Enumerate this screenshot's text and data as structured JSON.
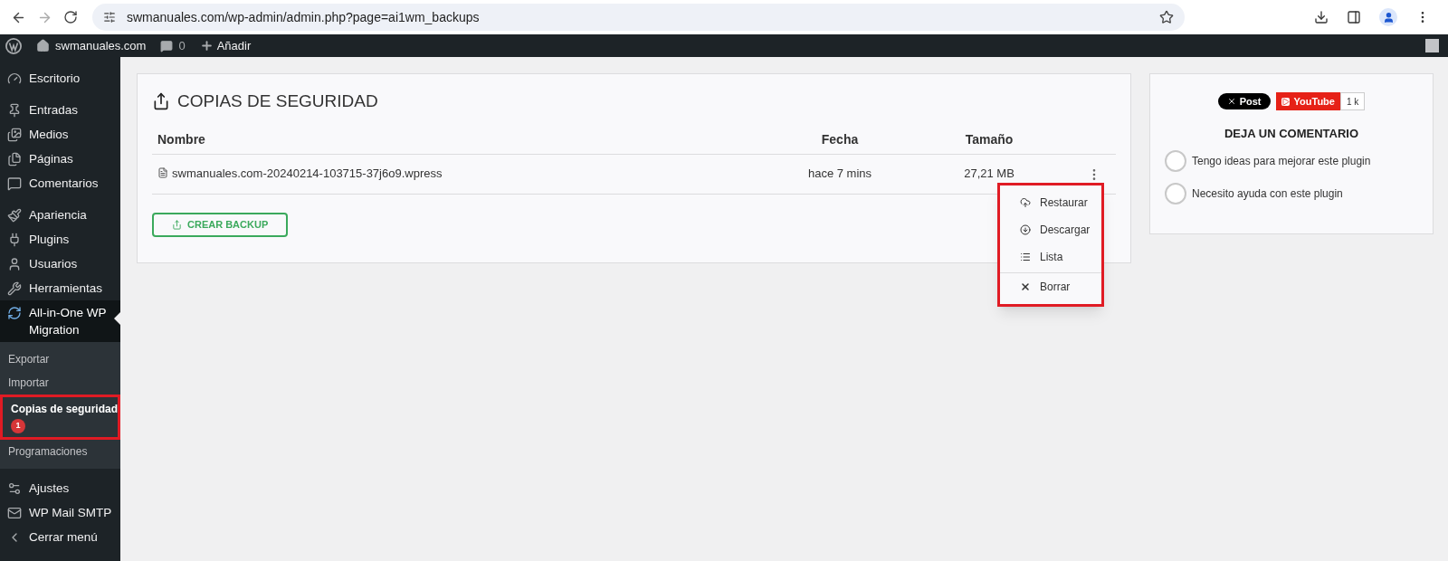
{
  "browser": {
    "url": "swmanuales.com/wp-admin/admin.php?page=ai1wm_backups"
  },
  "admin_bar": {
    "site": "swmanuales.com",
    "comments": "0",
    "new": "Añadir"
  },
  "sidebar": {
    "items": [
      {
        "kind": "dashboard",
        "label": "Escritorio",
        "selected": false
      },
      {
        "kind": "pin",
        "label": "Entradas",
        "selected": false
      },
      {
        "kind": "media",
        "label": "Medios",
        "selected": false
      },
      {
        "kind": "pages",
        "label": "Páginas",
        "selected": false
      },
      {
        "kind": "comments",
        "label": "Comentarios",
        "selected": false
      },
      {
        "kind": "brush",
        "label": "Apariencia",
        "selected": false
      },
      {
        "kind": "plug",
        "label": "Plugins",
        "selected": false
      },
      {
        "kind": "user",
        "label": "Usuarios",
        "selected": false
      },
      {
        "kind": "wrench",
        "label": "Herramientas",
        "selected": false
      },
      {
        "kind": "migration",
        "label": "All-in-One WP Migration",
        "selected": true,
        "children": [
          {
            "label": "Exportar",
            "selected": false
          },
          {
            "label": "Importar",
            "selected": false
          },
          {
            "label": "Copias de seguridad",
            "selected": true,
            "badge": "1"
          },
          {
            "label": "Programaciones",
            "selected": false
          }
        ]
      },
      {
        "kind": "settings",
        "label": "Ajustes",
        "selected": false
      },
      {
        "kind": "mail",
        "label": "WP Mail SMTP",
        "selected": false
      },
      {
        "kind": "collapse",
        "label": "Cerrar menú",
        "selected": false
      }
    ]
  },
  "backups": {
    "title": "COPIAS DE SEGURIDAD",
    "columns": [
      "Nombre",
      "Fecha",
      "Tamaño"
    ],
    "rows": [
      {
        "name": "swmanuales.com-20240214-103715-37j6o9.wpress",
        "date": "hace 7 mins",
        "size": "27,21 MB"
      }
    ],
    "button": "CREAR BACKUP",
    "menu": [
      {
        "kind": "restore",
        "label": "Restaurar"
      },
      {
        "kind": "download",
        "label": "Descargar"
      },
      {
        "kind": "list",
        "label": "Lista"
      },
      {
        "kind": "delete",
        "label": "Borrar"
      }
    ]
  },
  "feedback": {
    "x_post": "Post",
    "youtube": "YouTube",
    "youtube_count": "1 k",
    "title": "DEJA UN COMENTARIO",
    "options": [
      {
        "label": "Tengo ideas para mejorar este plugin",
        "selected": false
      },
      {
        "label": "Necesito ayuda con este plugin",
        "selected": false
      }
    ]
  }
}
